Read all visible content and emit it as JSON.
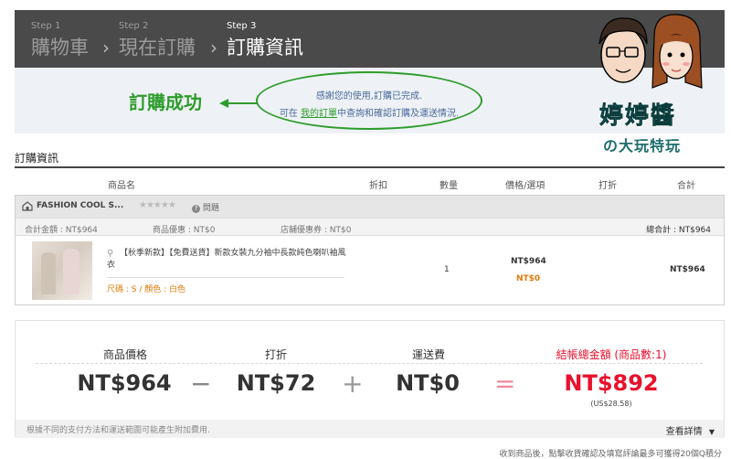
{
  "steps": [
    {
      "num": "Step 1",
      "label": "購物車"
    },
    {
      "num": "Step 2",
      "label": "現在訂購"
    },
    {
      "num": "Step 3",
      "label": "訂購資訊"
    }
  ],
  "step_arrow": "›",
  "confirm": {
    "success_label": "訂購成功",
    "line1": "感謝您的使用,訂購已完成.",
    "line2_prefix": "可在",
    "line2_link": "我的訂單",
    "line2_suffix": "中查詢和確認訂購及運送情況."
  },
  "brand": {
    "title": "婷婷醬",
    "subtitle": "の大玩特玩"
  },
  "section_title": "訂購資訊",
  "table_headers": [
    "商品名",
    "折扣",
    "數量",
    "價格/選項",
    "打折",
    "合計"
  ],
  "shop": {
    "name": "FASHION COOL S...",
    "stars": "★★★★★",
    "question": "問題",
    "total_amount": "合計金額 : NT$964",
    "product_discount": "商品優惠 : NT$0",
    "coupon": "店舖優惠券 : NT$0",
    "grand_total": "總合計 : NT$964"
  },
  "item": {
    "title": "【秋季新款】【免費送貨】新款女裝九分袖中長款純色喇叭袖風衣",
    "option": "尺碼 : S / 顏色 : 白色",
    "qty": "1",
    "price": "NT$964",
    "price_discount": "NT$0",
    "total": "NT$964"
  },
  "summary": {
    "labels": [
      "商品價格",
      "打折",
      "運送費",
      "結帳總金額 (商品數:1)"
    ],
    "values": [
      "NT$964",
      "NT$72",
      "NT$0",
      "NT$892"
    ],
    "ops": [
      "−",
      "+",
      "="
    ],
    "usd": "(US$28.58)",
    "note": "根據不同的支付方法和運送範圍可能產生附加費用.",
    "details": "查看詳情"
  },
  "footnote": "收到商品後，點擊收貨確認及填寫評論最多可獲得20個Q積分",
  "colors": {
    "accent_green": "#2e9c2b",
    "total_red": "#e8112d",
    "step_bar": "#4a4a4a"
  }
}
